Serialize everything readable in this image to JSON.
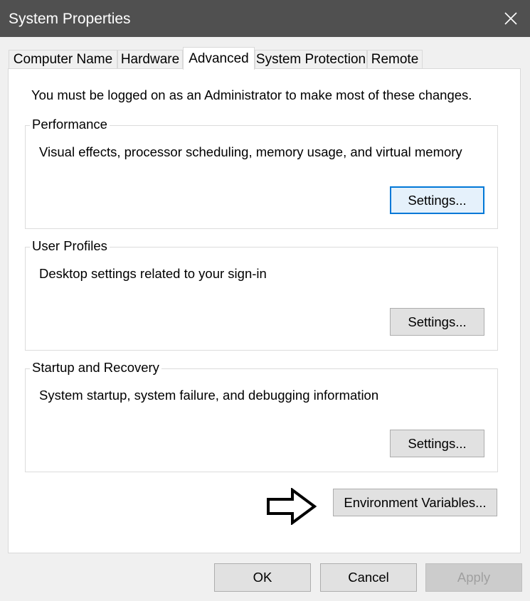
{
  "window": {
    "title": "System Properties",
    "close_icon": "close-icon"
  },
  "tabs": [
    {
      "label": "Computer Name"
    },
    {
      "label": "Hardware"
    },
    {
      "label": "Advanced",
      "active": true
    },
    {
      "label": "System Protection"
    },
    {
      "label": "Remote"
    }
  ],
  "advanced": {
    "admin_note": "You must be logged on as an Administrator to make most of these changes.",
    "performance": {
      "legend": "Performance",
      "description": "Visual effects, processor scheduling, memory usage, and virtual memory",
      "button": "Settings..."
    },
    "user_profiles": {
      "legend": "User Profiles",
      "description": "Desktop settings related to your sign-in",
      "button": "Settings..."
    },
    "startup_recovery": {
      "legend": "Startup and Recovery",
      "description": "System startup, system failure, and debugging information",
      "button": "Settings..."
    },
    "env_button": "Environment Variables..."
  },
  "footer": {
    "ok": "OK",
    "cancel": "Cancel",
    "apply": "Apply"
  },
  "colors": {
    "titlebar": "#505050",
    "focus_border": "#0078d7",
    "button_face": "#e1e1e1",
    "disabled_text": "#a0a0a0"
  }
}
